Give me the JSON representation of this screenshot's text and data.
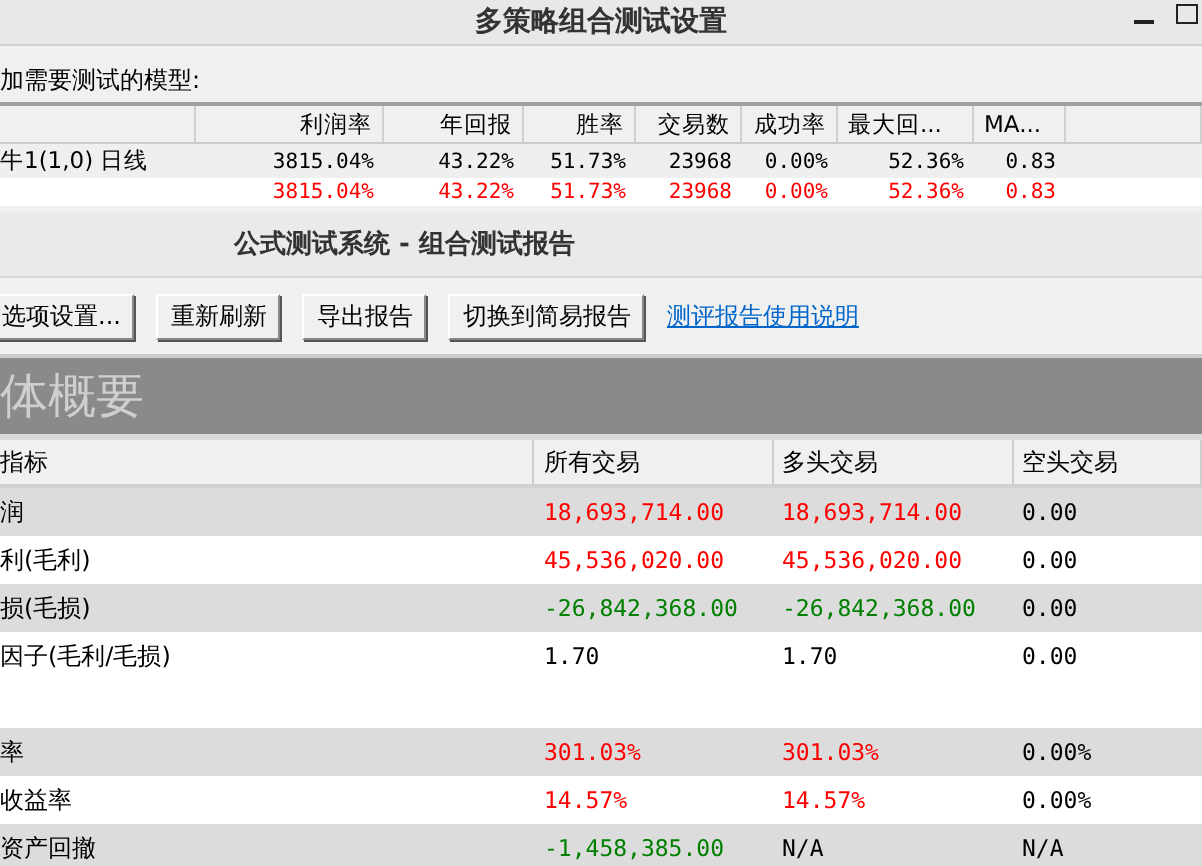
{
  "settings_window": {
    "title": "多策略组合测试设置",
    "prompt": "加需要测试的模型:",
    "columns": [
      "",
      "利润率",
      "年回报",
      "胜率",
      "交易数",
      "成功率",
      "最大回...",
      "MA..."
    ],
    "rows": [
      {
        "name": "牛1(1,0) 日线",
        "color": "#000000",
        "values": [
          "3815.04%",
          "43.22%",
          "51.73%",
          "23968",
          "0.00%",
          "52.36%",
          "0.83"
        ]
      },
      {
        "name": "",
        "color": "#ff0000",
        "values": [
          "3815.04%",
          "43.22%",
          "51.73%",
          "23968",
          "0.00%",
          "52.36%",
          "0.83"
        ]
      }
    ]
  },
  "report_window": {
    "title": "公式测试系统 - 组合测试报告",
    "buttons": [
      "选项设置...",
      "重新刷新",
      "导出报告",
      "切换到简易报告"
    ],
    "link": "测评报告使用说明",
    "banner": "体概要",
    "columns": [
      "指标",
      "所有交易",
      "多头交易",
      "空头交易"
    ],
    "groups": [
      [
        {
          "label": "润",
          "cells": [
            {
              "text": "18,693,714.00",
              "color": "#ff0000"
            },
            {
              "text": "18,693,714.00",
              "color": "#ff0000"
            },
            {
              "text": "0.00",
              "color": "#000000"
            }
          ]
        },
        {
          "label": "利(毛利)",
          "cells": [
            {
              "text": "45,536,020.00",
              "color": "#ff0000"
            },
            {
              "text": "45,536,020.00",
              "color": "#ff0000"
            },
            {
              "text": "0.00",
              "color": "#000000"
            }
          ]
        },
        {
          "label": "损(毛损)",
          "cells": [
            {
              "text": "-26,842,368.00",
              "color": "#008000"
            },
            {
              "text": "-26,842,368.00",
              "color": "#008000"
            },
            {
              "text": "0.00",
              "color": "#000000"
            }
          ]
        },
        {
          "label": "因子(毛利/毛损)",
          "cells": [
            {
              "text": "1.70",
              "color": "#000000"
            },
            {
              "text": "1.70",
              "color": "#000000"
            },
            {
              "text": "0.00",
              "color": "#000000"
            }
          ]
        }
      ],
      [
        {
          "label": "率",
          "cells": [
            {
              "text": "301.03%",
              "color": "#ff0000"
            },
            {
              "text": "301.03%",
              "color": "#ff0000"
            },
            {
              "text": "0.00%",
              "color": "#000000"
            }
          ]
        },
        {
          "label": "收益率",
          "cells": [
            {
              "text": "14.57%",
              "color": "#ff0000"
            },
            {
              "text": "14.57%",
              "color": "#ff0000"
            },
            {
              "text": "0.00%",
              "color": "#000000"
            }
          ]
        },
        {
          "label": "资产回撤",
          "cells": [
            {
              "text": "-1,458,385.00",
              "color": "#008000"
            },
            {
              "text": "N/A",
              "color": "#000000"
            },
            {
              "text": "N/A",
              "color": "#000000"
            }
          ]
        }
      ]
    ]
  }
}
